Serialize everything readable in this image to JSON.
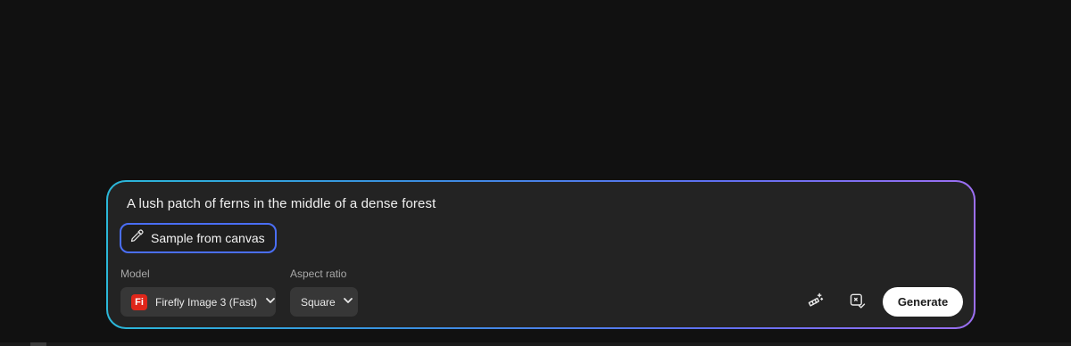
{
  "prompt": {
    "text": "A lush patch of ferns in the middle of a dense forest"
  },
  "sample_button": {
    "label": "Sample from canvas",
    "icon": "eyedropper-icon"
  },
  "model": {
    "label": "Model",
    "badge": "Fi",
    "value": "Firefly Image 3 (Fast)",
    "badge_color": "#e0261a"
  },
  "aspect_ratio": {
    "label": "Aspect ratio",
    "value": "Square"
  },
  "actions": {
    "style_icon": "magic-wand-icon",
    "effects_icon": "image-effects-icon",
    "generate_label": "Generate"
  },
  "colors": {
    "background": "#111111",
    "card": "#232323",
    "border_gradient_start": "#2bb8d9",
    "border_gradient_end": "#9c6ff2",
    "focus_outline": "#4a6ef5"
  }
}
